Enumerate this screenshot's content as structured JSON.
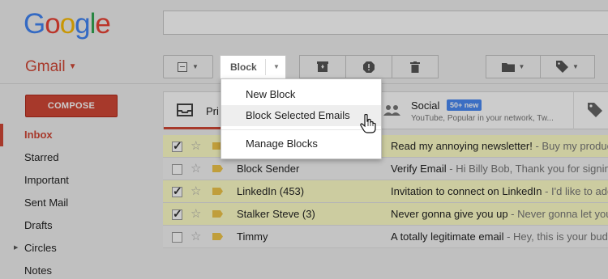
{
  "header": {
    "logo_letters": [
      "G",
      "o",
      "o",
      "g",
      "l",
      "e"
    ],
    "logo_colors": [
      "#4285f4",
      "#ea4335",
      "#fbbc05",
      "#4285f4",
      "#34a853",
      "#ea4335"
    ],
    "search_value": ""
  },
  "app": {
    "label": "Gmail"
  },
  "toolbar": {
    "block_label": "Block",
    "icons": [
      "select-checkbox-icon",
      "archive-icon",
      "report-spam-icon",
      "trash-icon",
      "folder-icon",
      "label-icon"
    ]
  },
  "menu": {
    "items": [
      {
        "label": "New Block"
      },
      {
        "label": "Block Selected Emails"
      },
      {
        "label": "Manage Blocks"
      }
    ],
    "hovered_index": 1
  },
  "compose_label": "COMPOSE",
  "nav": {
    "items": [
      {
        "label": "Inbox",
        "active": true
      },
      {
        "label": "Starred"
      },
      {
        "label": "Important"
      },
      {
        "label": "Sent Mail"
      },
      {
        "label": "Drafts"
      },
      {
        "label": "Circles",
        "expandable": true
      },
      {
        "label": "Notes"
      }
    ]
  },
  "tabs": {
    "primary_label": "Pri",
    "social": {
      "label": "Social",
      "badge": "50+ new",
      "sub": "YouTube, Popular in your network, Tw..."
    }
  },
  "emails": [
    {
      "selected": true,
      "sender": "",
      "subject": "Read my annoying newsletter!",
      "snippet": " - Buy my product"
    },
    {
      "selected": false,
      "sender": "Block Sender",
      "subject": "Verify Email",
      "snippet": " - Hi Billy Bob, Thank you for signing"
    },
    {
      "selected": true,
      "sender": "LinkedIn (453)",
      "subject": "Invitation to connect on LinkedIn",
      "snippet": " - I'd like to add"
    },
    {
      "selected": true,
      "sender": "Stalker Steve (3)",
      "subject": "Never gonna give you up",
      "snippet": " - Never gonna let you"
    },
    {
      "selected": false,
      "sender": "Timmy",
      "subject": "A totally legitimate email",
      "snippet": " - Hey, this is your buddy"
    }
  ],
  "colors": {
    "accent": "#d14836",
    "badge": "#4a8af4",
    "selected_row": "#ffffc9"
  }
}
